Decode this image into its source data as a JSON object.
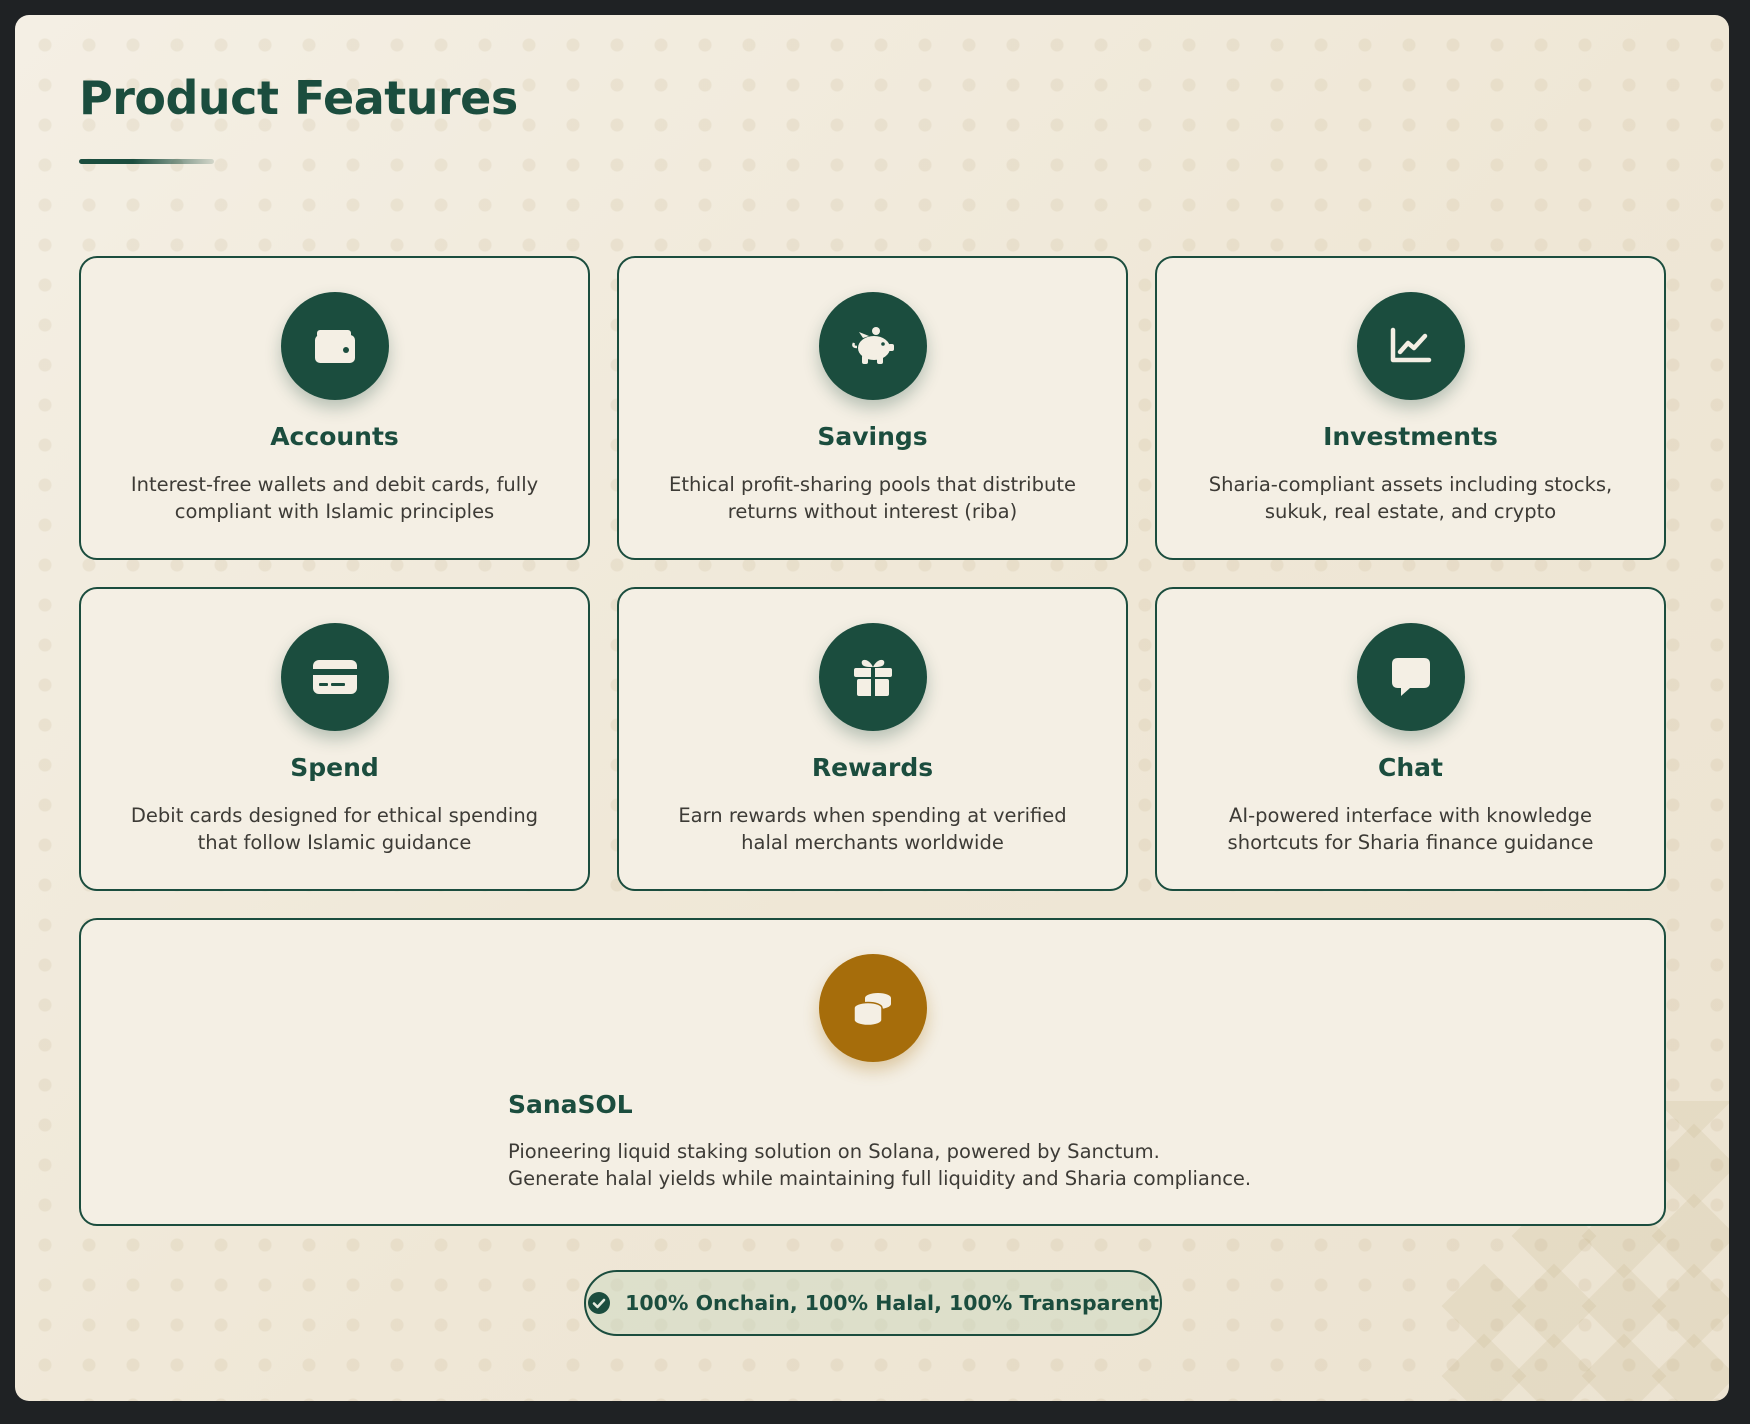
{
  "page": {
    "title": "Product Features"
  },
  "features": [
    {
      "icon": "wallet-icon",
      "title": "Accounts",
      "description": "Interest-free wallets and debit cards, fully compliant with Islamic principles"
    },
    {
      "icon": "piggy-bank-icon",
      "title": "Savings",
      "description": "Ethical profit-sharing pools that distribute returns without interest (riba)"
    },
    {
      "icon": "chart-line-icon",
      "title": "Investments",
      "description": "Sharia-compliant assets including stocks, sukuk, real estate, and crypto"
    },
    {
      "icon": "credit-card-icon",
      "title": "Spend",
      "description": "Debit cards designed for ethical spending that follow Islamic guidance"
    },
    {
      "icon": "gift-icon",
      "title": "Rewards",
      "description": "Earn rewards when spending at verified halal merchants worldwide"
    },
    {
      "icon": "chat-bubble-icon",
      "title": "Chat",
      "description": "AI-powered interface with knowledge shortcuts for Sharia finance guidance"
    }
  ],
  "highlight": {
    "icon": "coins-icon",
    "title": "SanaSOL",
    "line1": "Pioneering liquid staking solution on Solana, powered by Sanctum.",
    "line2": "Generate halal yields while maintaining full liquidity and Sharia compliance."
  },
  "badge": {
    "icon": "check-circle-icon",
    "text": "100% Onchain, 100% Halal, 100% Transparent"
  },
  "colors": {
    "primary": "#1b4d3e",
    "accent": "#a66d0b",
    "background": "#f4efe4"
  }
}
